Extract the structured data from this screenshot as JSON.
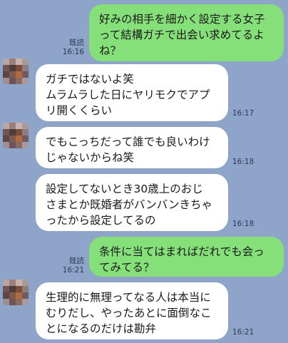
{
  "messages": [
    {
      "side": "me",
      "text": "好みの相手を細かく設定する女子\nって結構ガチで出会い求めてるよ\nね？",
      "read": "既読",
      "time": "16:16"
    },
    {
      "side": "them",
      "text": "ガチではないよ笑\nムラムラした日にヤリモクでアプ\nリ開くくらい",
      "time": "16:17"
    },
    {
      "side": "them",
      "text": "でもこっちだって誰でも良いわけ\nじゃないからね笑",
      "time": "16:18"
    },
    {
      "side": "them",
      "text": "設定してないとき30歳上のおじ\nさまとか既婚者がバンバンきちゃ\nったから設定してるの",
      "time": "16:18"
    },
    {
      "side": "me",
      "text": "条件に当てはまればだれでも会っ\nてみてる？",
      "read": "既読",
      "time": "16:21"
    },
    {
      "side": "them",
      "text": "生理的に無理ってなる人は本当に\nむりだし、やったあとに面倒なこ\nとになるのだけは勘弁",
      "time": "16:21"
    }
  ],
  "colors": {
    "background": "#8ea4c8",
    "my_bubble": "#85e07a",
    "their_bubble": "#ffffff"
  }
}
